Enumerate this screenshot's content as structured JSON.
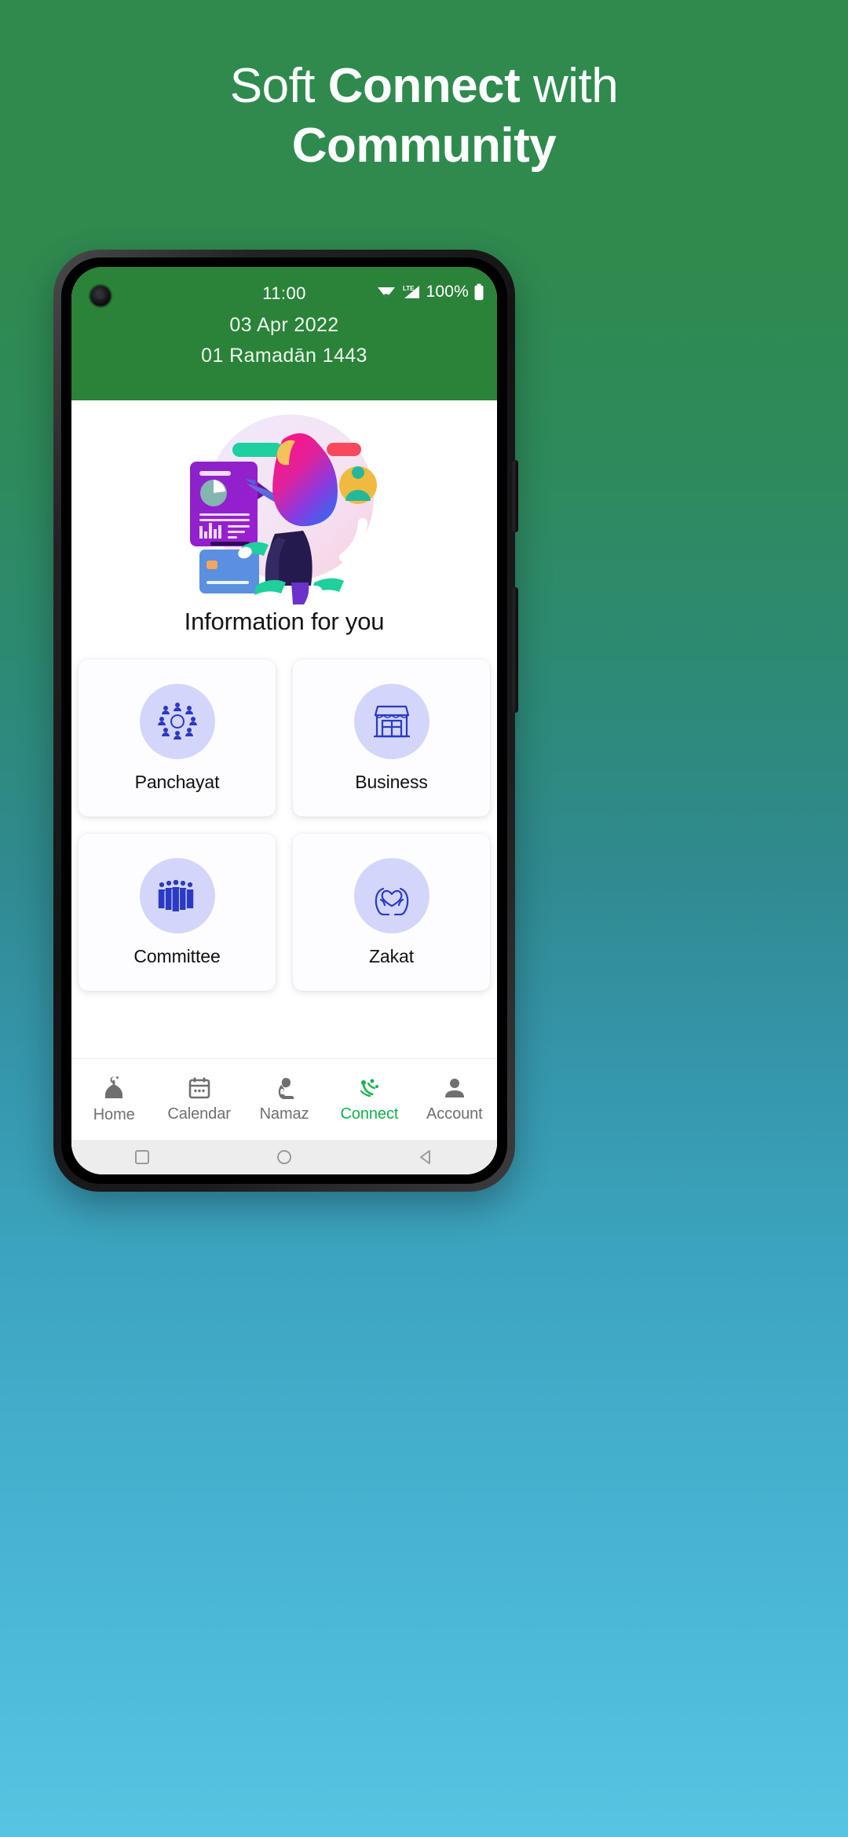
{
  "promo": {
    "line1_prefix": "Soft ",
    "line1_bold": "Connect",
    "line1_suffix": " with",
    "line2": "Community",
    "bg_top_color": "#2f8a4e",
    "bg_bottom_color": "#57c4e2"
  },
  "statusbar": {
    "time": "11:00",
    "battery_percent": "100%",
    "network_type": "LTE",
    "wifi_icon": "wifi-icon",
    "signal_icon": "signal-bars-icon",
    "battery_icon": "battery-full-icon",
    "camera_icon": "front-camera-punch-hole"
  },
  "header": {
    "gregorian_date": "03 Apr 2022",
    "hijri_date": "01 Ramadān 1443",
    "background_color": "#2b8239"
  },
  "main": {
    "illustration_name": "woman-with-documents-illustration",
    "section_title": "Information for you",
    "cards": [
      {
        "label": "Panchayat",
        "icon": "people-circle-group-icon"
      },
      {
        "label": "Business",
        "icon": "storefront-shop-icon"
      },
      {
        "label": "Committee",
        "icon": "people-row-group-icon"
      },
      {
        "label": "Zakat",
        "icon": "hands-holding-heart-icon"
      }
    ],
    "card_icon_bg": "#d3d6fa",
    "card_icon_color": "#2b39c4"
  },
  "bottom_nav": {
    "active_color": "#12b24a",
    "inactive_color": "#6f6f6f",
    "items": [
      {
        "label": "Home",
        "icon": "mosque-dome-crescent-icon",
        "active": false
      },
      {
        "label": "Calendar",
        "icon": "calendar-icon",
        "active": false
      },
      {
        "label": "Namaz",
        "icon": "praying-person-icon",
        "active": false
      },
      {
        "label": "Connect",
        "icon": "connect-signal-icon",
        "active": true
      },
      {
        "label": "Account",
        "icon": "person-account-icon",
        "active": false
      }
    ]
  },
  "system_bar": {
    "back_icon": "android-back-triangle-icon",
    "home_icon": "android-home-circle-icon",
    "recents_icon": "android-recents-square-icon"
  }
}
